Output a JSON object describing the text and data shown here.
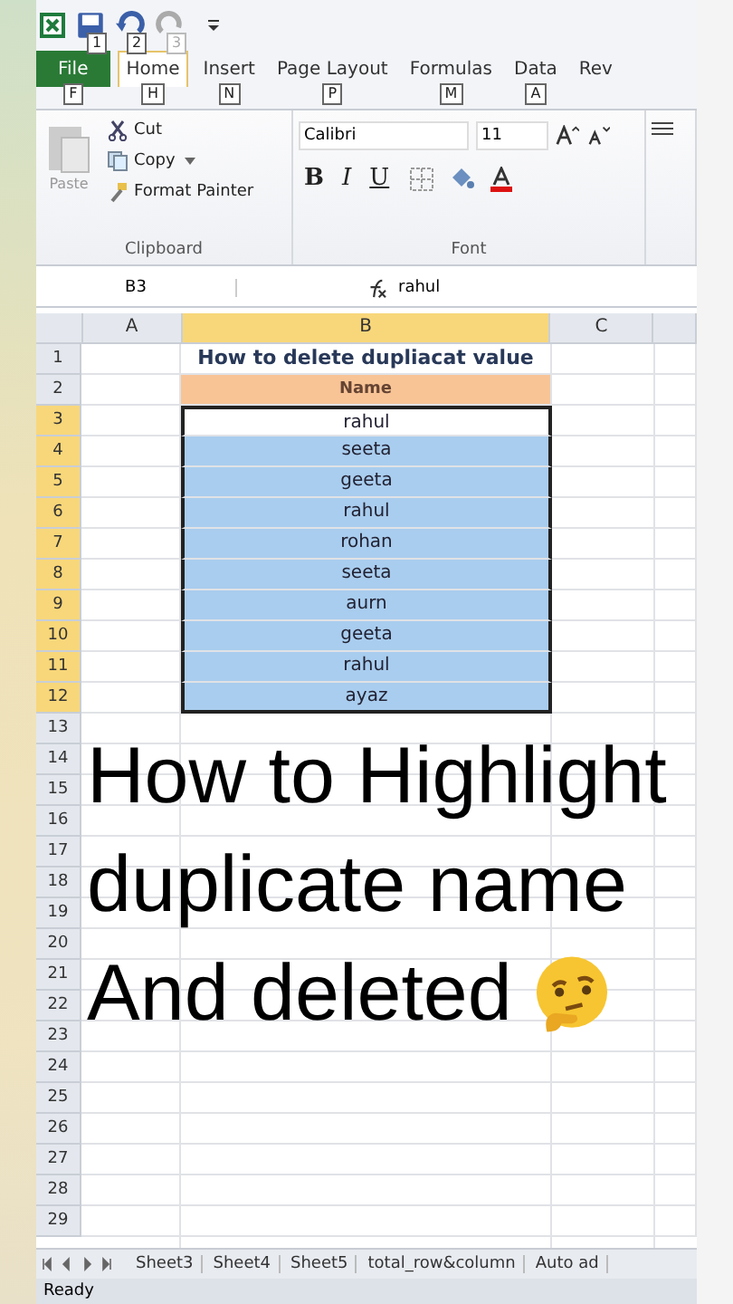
{
  "quick_access": {
    "keytips": [
      "1",
      "2",
      "3"
    ]
  },
  "tabs": [
    {
      "label": "File",
      "key": "F",
      "kind": "file",
      "selected": false
    },
    {
      "label": "Home",
      "key": "H",
      "kind": "tab",
      "selected": true
    },
    {
      "label": "Insert",
      "key": "N",
      "kind": "tab",
      "selected": false
    },
    {
      "label": "Page Layout",
      "key": "P",
      "kind": "tab",
      "selected": false
    },
    {
      "label": "Formulas",
      "key": "M",
      "kind": "tab",
      "selected": false
    },
    {
      "label": "Data",
      "key": "A",
      "kind": "tab",
      "selected": false
    },
    {
      "label": "Rev",
      "kind": "tab",
      "selected": false
    }
  ],
  "clipboard": {
    "paste": "Paste",
    "cut": "Cut",
    "copy": "Copy",
    "format_painter": "Format Painter",
    "label": "Clipboard"
  },
  "font": {
    "family": "Calibri",
    "size": "11",
    "bold": "B",
    "italic": "I",
    "underline": "U",
    "label": "Font"
  },
  "formula_bar": {
    "name_box": "B3",
    "value": "rahul"
  },
  "columns": [
    {
      "label": "A",
      "selected": false
    },
    {
      "label": "B",
      "selected": true
    },
    {
      "label": "C",
      "selected": false
    }
  ],
  "rows": [
    {
      "number": "1",
      "kind": "title",
      "b": "How to delete dupliacat value",
      "selected": false
    },
    {
      "number": "2",
      "kind": "header",
      "b": "Name",
      "selected": false
    },
    {
      "number": "3",
      "kind": "data",
      "b": "rahul",
      "selected": true,
      "active": true
    },
    {
      "number": "4",
      "kind": "data",
      "b": "seeta",
      "selected": true,
      "active": false
    },
    {
      "number": "5",
      "kind": "data",
      "b": "geeta",
      "selected": true,
      "active": false
    },
    {
      "number": "6",
      "kind": "data",
      "b": "rahul",
      "selected": true,
      "active": false
    },
    {
      "number": "7",
      "kind": "data",
      "b": "rohan",
      "selected": true,
      "active": false
    },
    {
      "number": "8",
      "kind": "data",
      "b": "seeta",
      "selected": true,
      "active": false
    },
    {
      "number": "9",
      "kind": "data",
      "b": "aurn",
      "selected": true,
      "active": false
    },
    {
      "number": "10",
      "kind": "data",
      "b": "geeta",
      "selected": true,
      "active": false
    },
    {
      "number": "11",
      "kind": "data",
      "b": "rahul",
      "selected": true,
      "active": false
    },
    {
      "number": "12",
      "kind": "data",
      "b": "ayaz",
      "selected": true,
      "active": false
    },
    {
      "number": "13",
      "kind": "empty",
      "selected": false
    },
    {
      "number": "14",
      "kind": "empty",
      "selected": false
    },
    {
      "number": "15",
      "kind": "empty",
      "selected": false
    },
    {
      "number": "16",
      "kind": "empty",
      "selected": false
    },
    {
      "number": "17",
      "kind": "empty",
      "selected": false
    },
    {
      "number": "18",
      "kind": "empty",
      "selected": false
    },
    {
      "number": "19",
      "kind": "empty",
      "selected": false
    },
    {
      "number": "20",
      "kind": "empty",
      "selected": false
    },
    {
      "number": "21",
      "kind": "empty",
      "selected": false
    },
    {
      "number": "22",
      "kind": "empty",
      "selected": false
    },
    {
      "number": "23",
      "kind": "empty",
      "selected": false
    },
    {
      "number": "24",
      "kind": "empty",
      "selected": false
    },
    {
      "number": "25",
      "kind": "empty",
      "selected": false
    },
    {
      "number": "26",
      "kind": "empty",
      "selected": false
    },
    {
      "number": "27",
      "kind": "empty",
      "selected": false
    },
    {
      "number": "28",
      "kind": "empty",
      "selected": false
    },
    {
      "number": "29",
      "kind": "empty",
      "selected": false
    }
  ],
  "sheet_tabs": [
    "Sheet3",
    "Sheet4",
    "Sheet5",
    "total_row&column",
    "Auto ad"
  ],
  "status_bar": {
    "text": "Ready"
  },
  "caption": {
    "lines": [
      "How to Highlight",
      "duplicate name",
      "And deleted"
    ]
  }
}
